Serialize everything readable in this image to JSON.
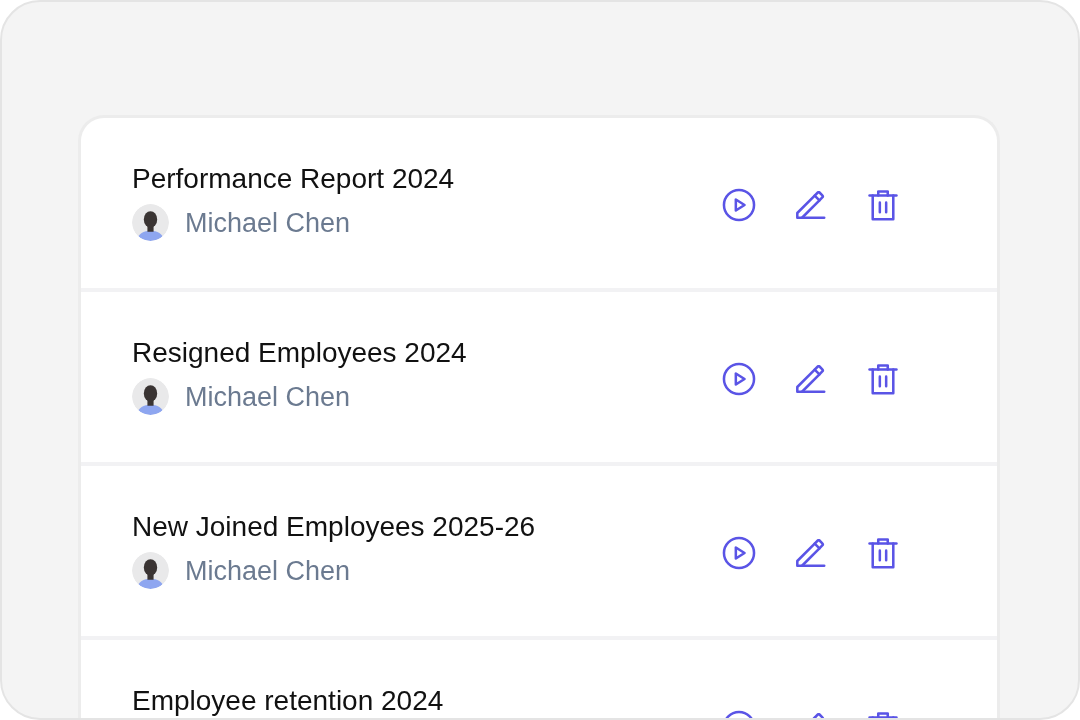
{
  "reports": [
    {
      "title": "Performance Report 2024",
      "author": "Michael Chen"
    },
    {
      "title": "Resigned Employees 2024",
      "author": "Michael Chen"
    },
    {
      "title": "New Joined Employees 2025-26",
      "author": "Michael Chen"
    },
    {
      "title": "Employee retention 2024"
    }
  ]
}
